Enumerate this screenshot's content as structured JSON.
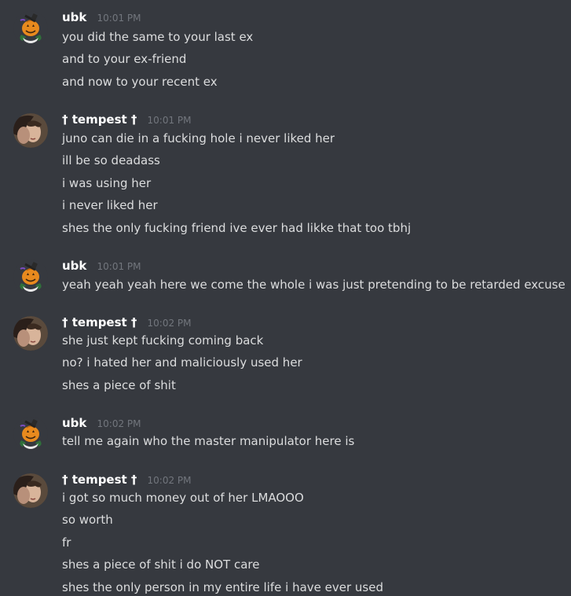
{
  "messages": [
    {
      "username": "ubk",
      "timestamp": "10:01 PM",
      "lines": [
        "you did the same to your last ex",
        "and to your ex-friend",
        "and now to your recent ex"
      ]
    },
    {
      "username": "† tempest †",
      "timestamp": "10:01 PM",
      "lines": [
        "juno can die in a fucking hole i never liked her",
        "ill be so deadass",
        "i was using her",
        "i never liked her",
        "shes the only fucking friend ive ever had likke that too tbhj"
      ]
    },
    {
      "username": "ubk",
      "timestamp": "10:01 PM",
      "lines": [
        "yeah yeah yeah here we come the whole i was just pretending to be retarded excuse"
      ]
    },
    {
      "username": "† tempest †",
      "timestamp": "10:02 PM",
      "lines": [
        "she just kept fucking coming back",
        "no? i hated her and maliciously used her",
        "shes a piece of shit"
      ]
    },
    {
      "username": "ubk",
      "timestamp": "10:02 PM",
      "lines": [
        "tell me again who the master manipulator here is"
      ]
    },
    {
      "username": "† tempest †",
      "timestamp": "10:02 PM",
      "lines": [
        "i got so much money out of her LMAOOO",
        "so worth",
        "fr",
        "shes a piece of shit i do NOT care",
        "shes the only person in my entire life i have ever used"
      ]
    }
  ],
  "colors": {
    "background": "#36393f",
    "username": "#ffffff",
    "message_text": "#dcddde",
    "timestamp": "#72767d"
  },
  "icons": {
    "ubk_avatar": "pumpkin-avatar-icon",
    "tempest_avatar": "portrait-avatar-icon"
  }
}
